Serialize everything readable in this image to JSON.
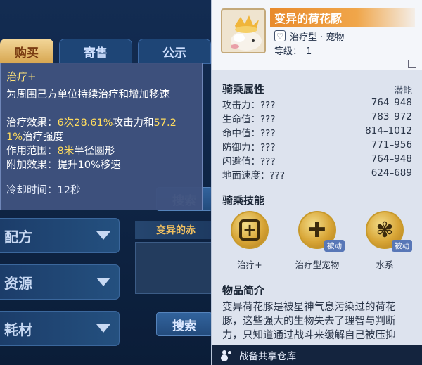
{
  "background": {
    "tabs": [
      "购买",
      "寄售",
      "公示"
    ],
    "left_menu": [
      "配方",
      "资源",
      "耗材"
    ],
    "card_title": "变异的赤",
    "search_label": "搜索"
  },
  "skill_tooltip": {
    "title": "治疗+",
    "description": "为周围己方单位持续治疗和增加移速",
    "effect_prefix": "治疗效果：",
    "effect_count": "6次",
    "effect_pct1": "28.61%",
    "effect_mid": "攻击力和",
    "effect_pct2": "57.2",
    "effect_pct2_cont": "1%",
    "effect_suffix": "治疗强度",
    "range_prefix": "作用范围：",
    "range_value": "8米",
    "range_suffix": "半径圆形",
    "extra_prefix": "附加效果：",
    "extra_value": "提升10%移速",
    "cooldown": "冷却时间：12秒"
  },
  "item": {
    "name": "变异的荷花豚",
    "type": "治疗型 · 宠物",
    "level_label": "等级：",
    "level_value": "1",
    "stats_title": "骑乘属性",
    "stats_potential": "潜能",
    "stats": [
      {
        "label": "攻击力：???",
        "value": "764–948"
      },
      {
        "label": "生命值：???",
        "value": "783–972"
      },
      {
        "label": "命中值：???",
        "value": "814–1012"
      },
      {
        "label": "防御力：???",
        "value": "771–956"
      },
      {
        "label": "闪避值：???",
        "value": "764–948"
      },
      {
        "label": "地面速度：???",
        "value": "624–689"
      }
    ],
    "skills_title": "骑乘技能",
    "skills": [
      {
        "label": "治疗+",
        "icon": "heal-plus-icon",
        "passive": ""
      },
      {
        "label": "治疗型宠物",
        "icon": "pet-heal-icon",
        "passive": "被动"
      },
      {
        "label": "水系",
        "icon": "paw-icon",
        "passive": "被动"
      }
    ],
    "intro_title": "物品简介",
    "intro": "变异荷花豚是被星神气息污染过的荷花豚，这些强大的生物失去了理智与判断力，只知道通过战斗来缓解自己被压抑"
  },
  "footer": {
    "label": "战备共享仓库"
  },
  "colors": {
    "highlight": "#ffdc5e",
    "name_bar": "#e88a2c",
    "passive_tag": "#5877b7"
  }
}
